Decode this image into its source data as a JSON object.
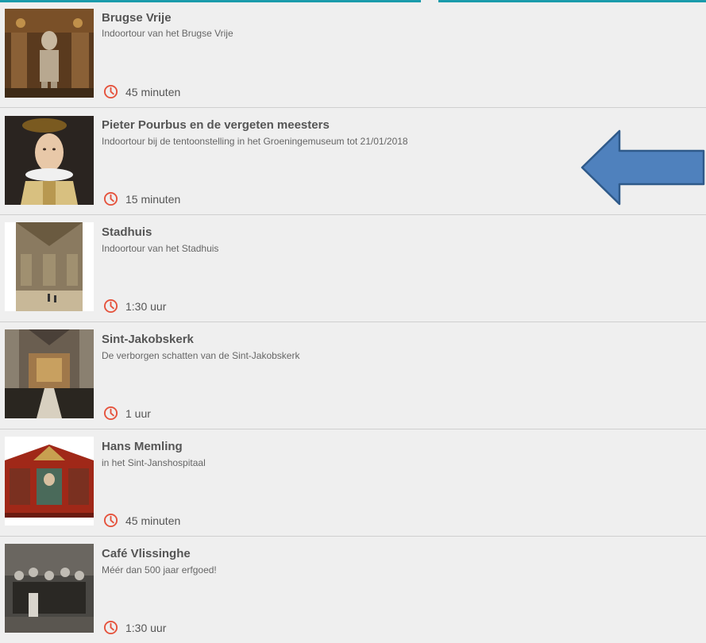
{
  "tours": [
    {
      "title": "Brugse Vrije",
      "subtitle": "Indoortour van het Brugse Vrije",
      "duration": "45 minuten",
      "thumb_icon": "armor-statue-image"
    },
    {
      "title": "Pieter Pourbus en de vergeten meesters",
      "subtitle": "Indoortour bij de tentoonstelling in het Groeningemuseum  tot 21/01/2018",
      "duration": "15 minuten",
      "thumb_icon": "portrait-painting-image"
    },
    {
      "title": "Stadhuis",
      "subtitle": "Indoortour van het Stadhuis",
      "duration": "1:30 uur",
      "thumb_icon": "gothic-hall-image"
    },
    {
      "title": "Sint-Jakobskerk",
      "subtitle": "De verborgen schatten van de Sint-Jakobskerk",
      "duration": "1 uur",
      "thumb_icon": "church-interior-image"
    },
    {
      "title": "Hans Memling",
      "subtitle": "in het Sint-Janshospitaal",
      "duration": "45 minuten",
      "thumb_icon": "shrine-image"
    },
    {
      "title": "Café Vlissinghe",
      "subtitle": "Méér dan 500 jaar erfgoed!",
      "duration": "1:30 uur",
      "thumb_icon": "old-photo-image"
    }
  ],
  "colors": {
    "accent": "#1a9bab",
    "clock": "#e5533d",
    "arrow": "#4f81bd",
    "arrow_border": "#2f5a8a",
    "background": "#efefef"
  }
}
